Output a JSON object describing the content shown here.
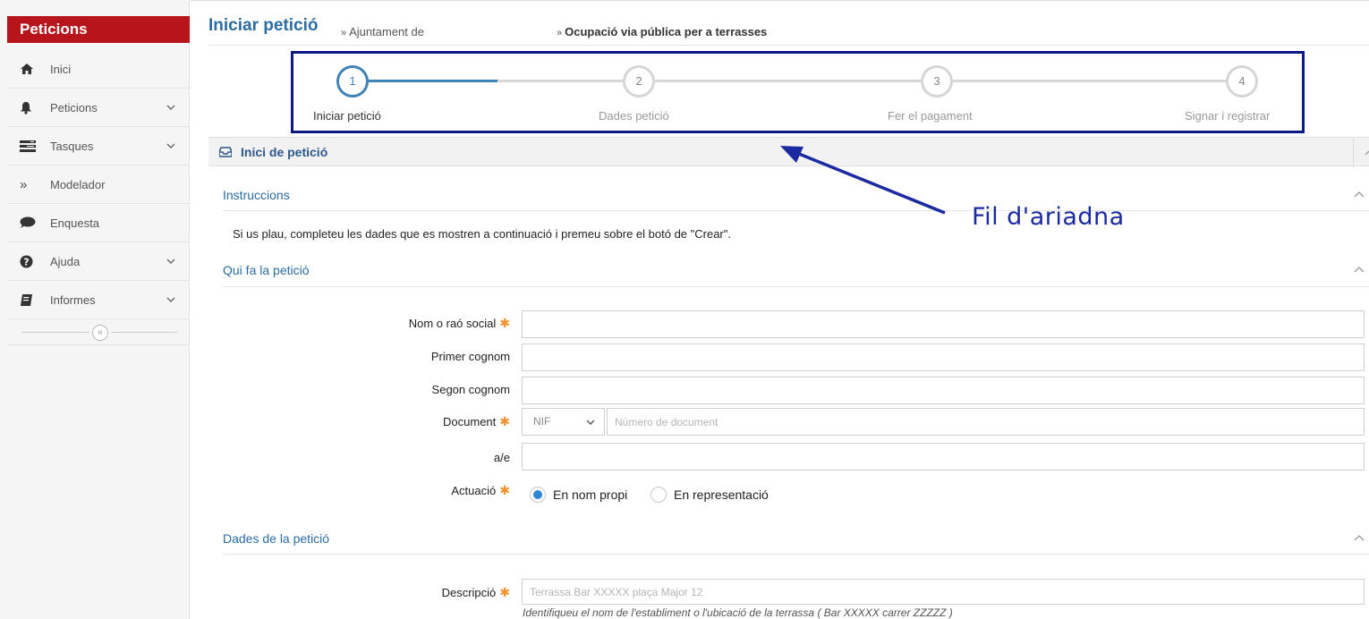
{
  "sidebar": {
    "title": "Peticions",
    "items": [
      {
        "label": "Inici",
        "icon": "home-icon"
      },
      {
        "label": "Peticions",
        "icon": "bell-icon",
        "expandable": true
      },
      {
        "label": "Tasques",
        "icon": "tasks-icon",
        "expandable": true
      },
      {
        "label": "Modelador",
        "icon": "double-chevron-right-icon"
      },
      {
        "label": "Enquesta",
        "icon": "chat-bubble-icon"
      },
      {
        "label": "Ajuda",
        "icon": "question-circle-icon",
        "expandable": true
      },
      {
        "label": "Informes",
        "icon": "book-icon",
        "expandable": true
      }
    ],
    "collapse_glyph": "«"
  },
  "header": {
    "title": "Iniciar petició",
    "sep": "»",
    "breadcrumb": [
      "Ajuntament de",
      "Ocupació via pública per a terrasses"
    ]
  },
  "wizard": {
    "steps": [
      {
        "number": "1",
        "label": "Iniciar petició",
        "active": true
      },
      {
        "number": "2",
        "label": "Dades petició",
        "active": false
      },
      {
        "number": "3",
        "label": "Fer el pagament",
        "active": false
      },
      {
        "number": "4",
        "label": "Signar i registrar",
        "active": false
      }
    ],
    "progress": 0.5,
    "border_color": "#0b1a87",
    "active_color": "#3f82b8"
  },
  "panel": {
    "title": "Inici de petició",
    "icon": "inbox-icon"
  },
  "sections": {
    "instructions": {
      "title": "Instruccions",
      "text": "Si us plau, completeu les dades que es mostren a continuació i premeu sobre el botó de \"Crear\"."
    },
    "requester": {
      "title": "Qui fa la petició",
      "fields": {
        "name": {
          "label": "Nom o raó social",
          "required": true,
          "value": ""
        },
        "surname1": {
          "label": "Primer cognom",
          "required": false,
          "value": ""
        },
        "surname2": {
          "label": "Segon cognom",
          "required": false,
          "value": ""
        },
        "document": {
          "label": "Document",
          "required": true,
          "type_value": "NIF",
          "number_placeholder": "Número de document"
        },
        "email": {
          "label": "a/e",
          "required": false,
          "value": ""
        },
        "actuacio": {
          "label": "Actuació",
          "required": true,
          "options": [
            "En nom propi",
            "En representació"
          ],
          "selected": "En nom propi"
        }
      }
    },
    "request_data": {
      "title": "Dades de la petició",
      "fields": {
        "description": {
          "label": "Descripció",
          "required": true,
          "placeholder": "Terrassa Bar XXXXX plaça Major 12",
          "help": "Identifiqueu el nom de l'establiment o l'ubicació de la terrassa ( Bar XXXXX carrer ZZZZZ )"
        }
      }
    }
  },
  "annotation": {
    "text": "Fil d'ariadna",
    "color": "#1b2aa0"
  },
  "colors": {
    "brand_red": "#b8141b",
    "link_blue": "#2b6ca3",
    "required_orange": "#f0902e",
    "radio_blue": "#2f86d4"
  }
}
